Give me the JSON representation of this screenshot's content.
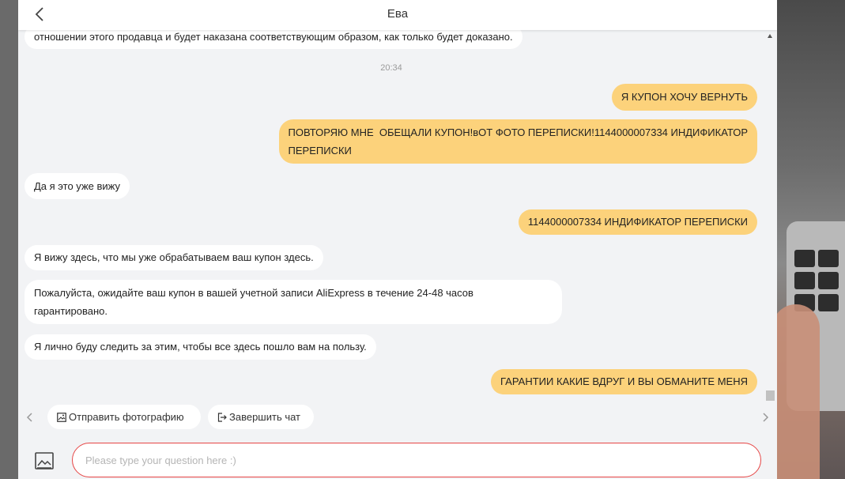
{
  "header": {
    "title": "Ева",
    "back_icon": "chevron-left-icon"
  },
  "messages": [
    {
      "side": "in",
      "text": "отношении этого продавца и будет наказана соответствующим образом, как только будет доказано."
    },
    {
      "timestamp": "20:34"
    },
    {
      "side": "out",
      "text": "Я КУПОН ХОЧУ ВЕРНУТЬ"
    },
    {
      "side": "out",
      "lines": [
        "ПОВТОРЯЮ МНЕ  ОБЕЩАЛИ КУПОН!вОТ ФОТО ПЕРЕПИСКИ!1144000007334 ИНДИФИКАТОР",
        "ПЕРЕПИСКИ"
      ]
    },
    {
      "side": "in",
      "text": "Да я это уже вижу"
    },
    {
      "side": "out",
      "text": "1144000007334 ИНДИФИКАТОР ПЕРЕПИСКИ"
    },
    {
      "side": "in",
      "text": "Я вижу здесь, что мы уже обрабатываем ваш купон здесь."
    },
    {
      "side": "in",
      "lines": [
        "Пожалуйста, ожидайте ваш купон в вашей учетной записи AliExpress в течение 24-48 часов",
        "гарантировано."
      ]
    },
    {
      "side": "in",
      "text": "Я лично буду следить за этим, чтобы все здесь пошло вам на пользу."
    },
    {
      "side": "out",
      "text": "ГАРАНТИИ КАКИЕ ВДРУГ И ВЫ ОБМАНИТЕ МЕНЯ"
    }
  ],
  "quick_actions": {
    "send_photo": {
      "label": "Отправить фотографию",
      "icon": "photo-icon"
    },
    "end_chat": {
      "label": "Завершить чат",
      "icon": "exit-icon"
    }
  },
  "composer": {
    "placeholder": "Please type your question here :)",
    "value": "",
    "image_icon": "image-icon"
  },
  "colors": {
    "outgoing_bubble": "#fcd27b",
    "incoming_bubble": "#ffffff",
    "chat_background": "#f2f3f5",
    "input_border": "#e64545"
  }
}
